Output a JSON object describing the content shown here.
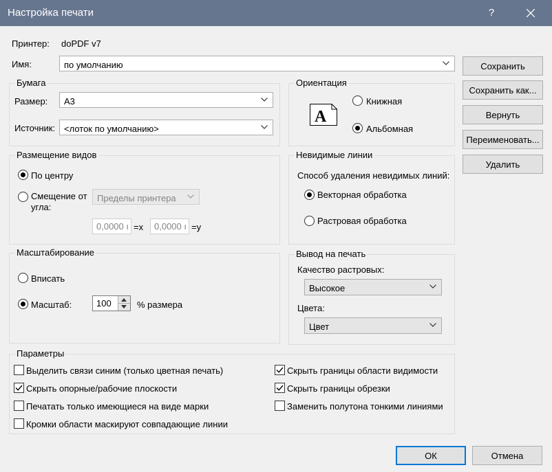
{
  "window": {
    "title": "Настройка печати",
    "help_label": "?"
  },
  "printer": {
    "label": "Принтер:",
    "value": "doPDF v7"
  },
  "name": {
    "label": "Имя:",
    "value": "по умолчанию"
  },
  "paper": {
    "legend": "Бумага",
    "size_label": "Размер:",
    "size_value": "A3",
    "source_label": "Источник:",
    "source_value": "<лоток по умолчанию>"
  },
  "orientation": {
    "legend": "Ориентация",
    "portrait": "Книжная",
    "landscape": "Альбомная",
    "selected": "landscape"
  },
  "placement": {
    "legend": "Размещение видов",
    "center": "По центру",
    "offset_line1": "Смещение от",
    "offset_line2": "угла:",
    "from_value": "Пределы принтера",
    "x_value": "0,0000 ı",
    "x_label": "=x",
    "y_value": "0,0000 ı",
    "y_label": "=y",
    "selected": "center"
  },
  "hidden_lines": {
    "legend": "Невидимые линии",
    "method_label": "Способ удаления невидимых линий:",
    "vector": "Векторная обработка",
    "raster": "Растровая обработка",
    "selected": "vector"
  },
  "scaling": {
    "legend": "Масштабирование",
    "fit": "Вписать",
    "zoom": "Масштаб:",
    "zoom_value": "100",
    "percent_label": "% размера",
    "selected": "zoom"
  },
  "output": {
    "legend": "Вывод на печать",
    "quality_label": "Качество растровых:",
    "quality_value": "Высокое",
    "colors_label": "Цвета:",
    "colors_value": "Цвет"
  },
  "params": {
    "legend": "Параметры",
    "left": [
      {
        "label": "Выделить связи синим (только цветная печать)",
        "checked": false
      },
      {
        "label": "Скрыть опорные/рабочие плоскости",
        "checked": true
      },
      {
        "label": "Печатать только имеющиеся на виде марки",
        "checked": false
      },
      {
        "label": "Кромки области маскируют совпадающие линии",
        "checked": false
      }
    ],
    "right": [
      {
        "label": "Скрыть границы области видимости",
        "checked": true
      },
      {
        "label": "Скрыть границы обрезки",
        "checked": true
      },
      {
        "label": "Заменить полутона тонкими линиями",
        "checked": false
      }
    ]
  },
  "side_buttons": {
    "save": "Сохранить",
    "save_as": "Сохранить как...",
    "revert": "Вернуть",
    "rename": "Переименовать...",
    "delete": "Удалить"
  },
  "footer": {
    "ok": "ОК",
    "cancel": "Отмена"
  },
  "colors": {
    "titlebar": "#67768f",
    "default_button_border": "#0078d7"
  }
}
